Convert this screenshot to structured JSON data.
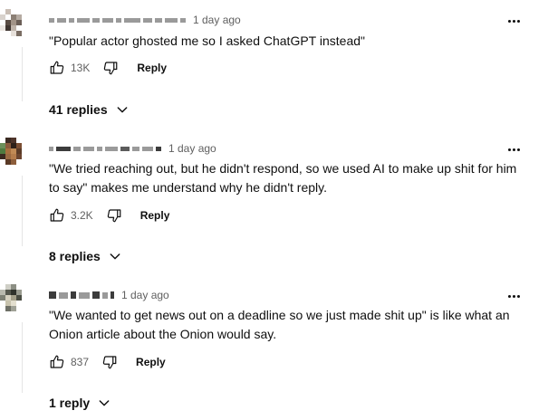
{
  "comments": [
    {
      "author": "",
      "time": "1 day ago",
      "text": "\"Popular actor ghosted me so I asked ChatGPT instead\"",
      "likes": "13K",
      "reply_label": "Reply",
      "replies_label": "41 replies"
    },
    {
      "author": "",
      "time": "1 day ago",
      "text": "\"We tried reaching out, but he didn't respond, so we used AI to make up shit for him to say\" makes me understand why he didn't reply.",
      "likes": "3.2K",
      "reply_label": "Reply",
      "replies_label": "8 replies"
    },
    {
      "author": "",
      "time": "1 day ago",
      "text": "\"We wanted to get news out on a deadline so we just made shit up\" is like what an Onion article about the Onion would say.",
      "likes": "837",
      "reply_label": "Reply",
      "replies_label": "1 reply"
    }
  ],
  "icons": {
    "like": "thumbs-up-icon",
    "dislike": "thumbs-down-icon",
    "more": "more-vert-icon",
    "chevron": "chevron-down-icon"
  },
  "colors": {
    "text": "#0f0f0f",
    "secondary": "#606060",
    "thread_line": "#e5e5e5"
  }
}
